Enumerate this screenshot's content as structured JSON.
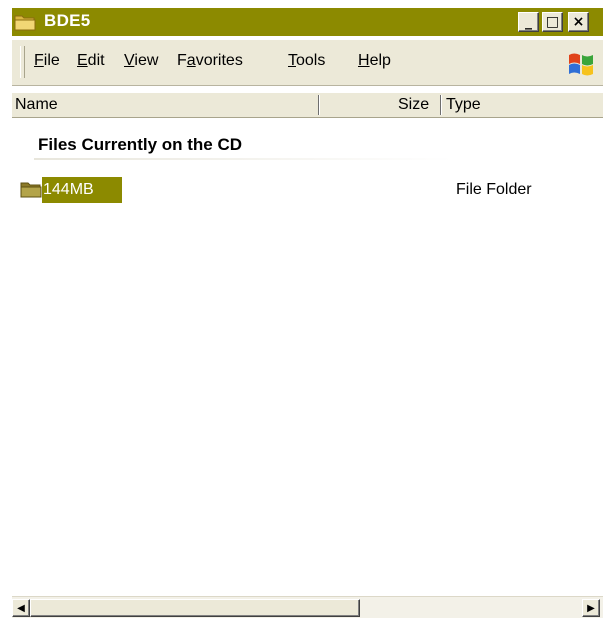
{
  "window": {
    "title": "BDE5",
    "title_bar_color": "#8c8a00",
    "title_icon": "folder-icon",
    "controls": {
      "minimize": "_",
      "maximize": "□",
      "close": "×"
    }
  },
  "menu": {
    "items": [
      {
        "label": "File",
        "access_key": "F"
      },
      {
        "label": "Edit",
        "access_key": "E"
      },
      {
        "label": "View",
        "access_key": "V"
      },
      {
        "label": "Favorites",
        "access_key": "a"
      },
      {
        "label": "Tools",
        "access_key": "T"
      },
      {
        "label": "Help",
        "access_key": "H"
      }
    ],
    "logo_icon": "windows-logo-icon"
  },
  "columns": [
    "Name",
    "Size",
    "Type"
  ],
  "group": {
    "title": "Files Currently on the CD"
  },
  "files": [
    {
      "name": "144MB",
      "size": "",
      "type": "File Folder",
      "icon": "folder-icon",
      "selected": true
    }
  ],
  "scrollbar": {
    "left_arrow": "◀",
    "right_arrow": "▶"
  },
  "colors": {
    "selection": "#8c8a00",
    "chrome": "#ece9d8"
  }
}
